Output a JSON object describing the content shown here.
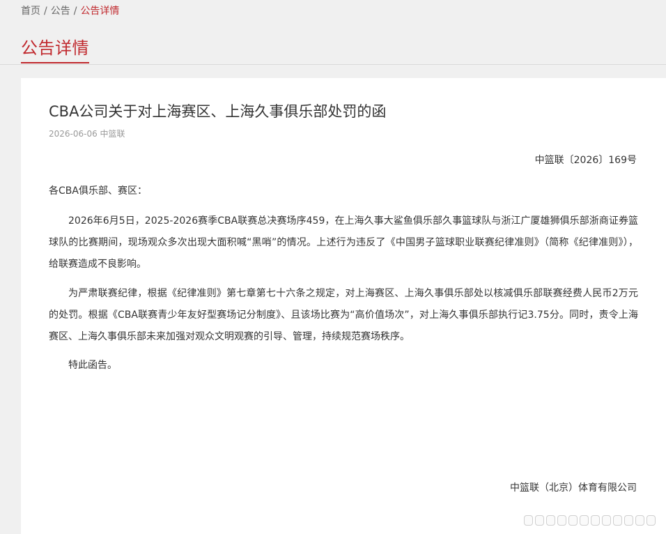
{
  "breadcrumb": {
    "home": "首页",
    "separator": "/",
    "notices": "公告",
    "current": "公告详情"
  },
  "section": {
    "title": "公告详情"
  },
  "article": {
    "title": "CBA公司关于对上海赛区、上海久事俱乐部处罚的函",
    "meta": "2026-06-06 中篮联",
    "doc_number": "中篮联〔2026〕169号",
    "salutation": "各CBA俱乐部、赛区：",
    "paragraphs": [
      "2026年6月5日，2025-2026赛季CBA联赛总决赛场序459，在上海久事大鲨鱼俱乐部久事篮球队与浙江广厦雄狮俱乐部浙商证券篮球队的比赛期间，现场观众多次出现大面积喊“黑哨”的情况。上述行为违反了《中国男子篮球职业联赛纪律准则》（简称《纪律准则》），给联赛造成不良影响。",
      "为严肃联赛纪律，根据《纪律准则》第七章第七十六条之规定，对上海赛区、上海久事俱乐部处以核减俱乐部联赛经费人民币2万元的处罚。根据《CBA联赛青少年友好型赛场记分制度》、且该场比赛为“高价值场次”，对上海久事俱乐部执行记3.75分。同时，责令上海赛区、上海久事俱乐部未来加强对观众文明观赛的引导、管理，持续规范赛场秩序。",
      "特此函告。"
    ],
    "signature": "中篮联（北京）体育有限公司"
  }
}
